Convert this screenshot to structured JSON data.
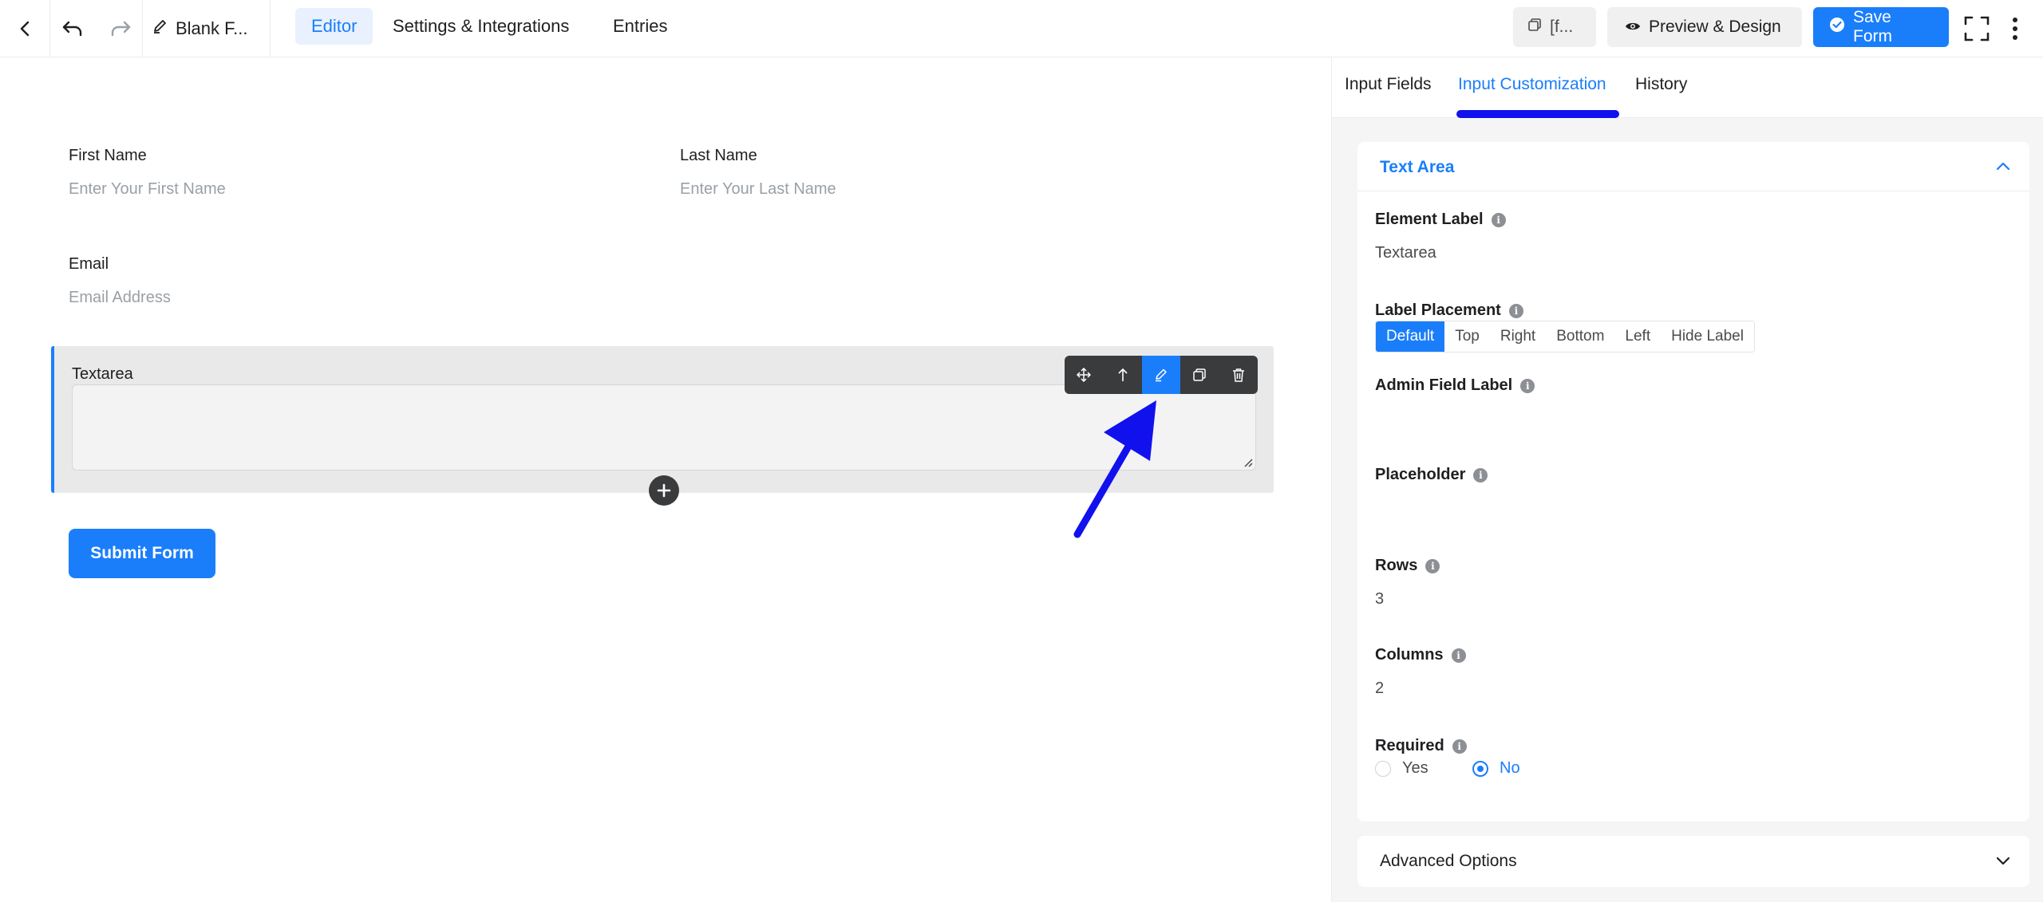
{
  "topbar": {
    "form_title": "Blank F...",
    "tabs": [
      "Editor",
      "Settings & Integrations",
      "Entries"
    ],
    "shortcode_label": "[f...",
    "preview_label": "Preview & Design",
    "save_label": "Save Form"
  },
  "form": {
    "first_name": {
      "label": "First Name",
      "placeholder": "Enter Your First Name"
    },
    "last_name": {
      "label": "Last Name",
      "placeholder": "Enter Your Last Name"
    },
    "email": {
      "label": "Email",
      "placeholder": "Email Address"
    },
    "textarea": {
      "label": "Textarea"
    },
    "submit_label": "Submit Form"
  },
  "panel": {
    "tabs": [
      "Input Fields",
      "Input Customization",
      "History"
    ],
    "section_title": "Text Area",
    "element_label": {
      "label": "Element Label",
      "value": "Textarea"
    },
    "label_placement": {
      "label": "Label Placement",
      "options": [
        "Default",
        "Top",
        "Right",
        "Bottom",
        "Left",
        "Hide Label"
      ],
      "selected": "Default"
    },
    "admin_field_label": {
      "label": "Admin Field Label",
      "value": ""
    },
    "placeholder": {
      "label": "Placeholder",
      "value": ""
    },
    "rows": {
      "label": "Rows",
      "value": "3"
    },
    "columns": {
      "label": "Columns",
      "value": "2"
    },
    "required": {
      "label": "Required",
      "options": [
        "Yes",
        "No"
      ],
      "selected": "No"
    },
    "advanced_title": "Advanced Options"
  },
  "colors": {
    "accent": "#1a7efb",
    "annotation": "#1111ee"
  }
}
